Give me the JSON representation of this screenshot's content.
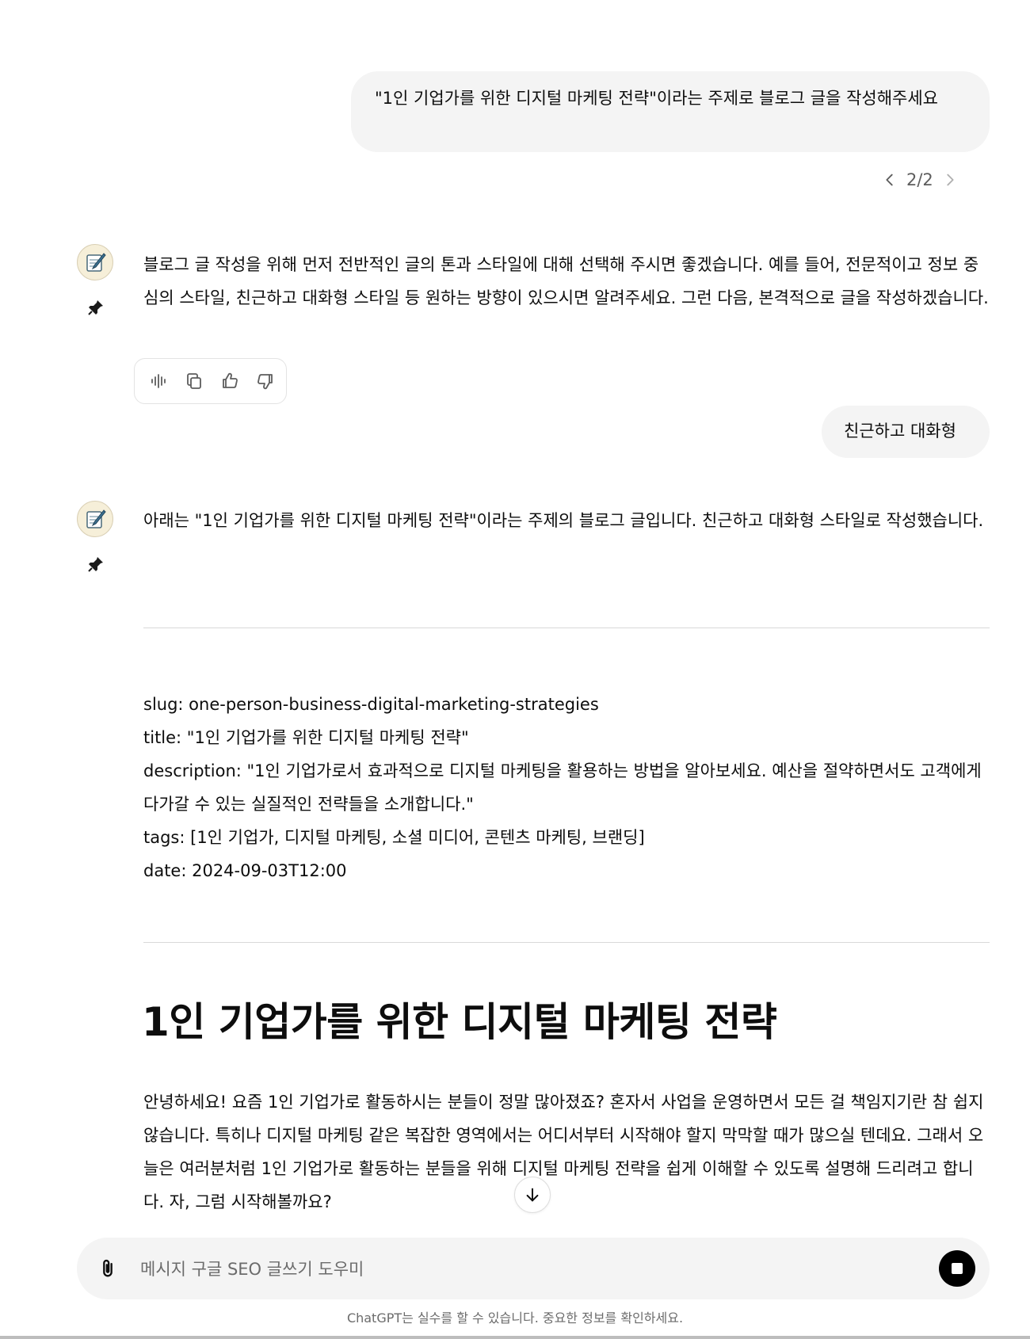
{
  "messages": {
    "user1": "\"1인 기업가를 위한 디지털 마케팅 전략\"이라는 주제로 블로그 글을 작성해주세요",
    "pager": "2/2",
    "assistant1": "블로그 글 작성을 위해 먼저 전반적인 글의 톤과 스타일에 대해 선택해 주시면 좋겠습니다. 예를 들어, 전문적이고 정보 중심의 스타일, 친근하고 대화형 스타일 등 원하는 방향이 있으시면 알려주세요. 그런 다음, 본격적으로 글을 작성하겠습니다.",
    "user2": "친근하고 대화형",
    "assistant2": "아래는 \"1인 기업가를 위한 디지털 마케팅 전략\"이라는 주제의 블로그 글입니다. 친근하고 대화형 스타일로 작성했습니다."
  },
  "actions": [
    "read-aloud-icon",
    "copy-icon",
    "thumbs-up-icon",
    "thumbs-down-icon"
  ],
  "meta": {
    "slug": "slug: one-person-business-digital-marketing-strategies",
    "title": "title: \"1인 기업가를 위한 디지털 마케팅 전략\"",
    "description": "description: \"1인 기업가로서 효과적으로 디지털 마케팅을 활용하는 방법을 알아보세요. 예산을 절약하면서도 고객에게 다가갈 수 있는 실질적인 전략들을 소개합니다.\"",
    "tags": "tags: [1인 기업가, 디지털 마케팅, 소셜 미디어, 콘텐츠 마케팅, 브랜딩]",
    "date": "date: 2024-09-03T12:00"
  },
  "blog": {
    "heading": "1인 기업가를 위한 디지털 마케팅 전략",
    "intro": "안녕하세요! 요즘 1인 기업가로 활동하시는 분들이 정말 많아졌죠? 혼자서 사업을 운영하면서 모든 걸 책임지기란 참 쉽지 않습니다. 특히나 디지털 마케팅 같은 복잡한 영역에서는 어디서부터 시작해야 할지 막막할 때가 많으실 텐데요. 그래서 오늘은 여러분처럼 1인 기업가로 활동하는 분들을 위해 디지털 마케팅 전략을 쉽게 이해할 수 있도록 설명해 드리려고 합니다. 자, 그럼 시작해볼까요?"
  },
  "composer": {
    "placeholder": "메시지 구글 SEO 글쓰기 도우미"
  },
  "footer": "ChatGPT는 실수를 할 수 있습니다. 중요한 정보를 확인하세요.",
  "colors": {
    "bubble": "#f4f4f4",
    "text": "#0d0d0d",
    "muted": "#6b6b6b",
    "stop_button": "#000000"
  }
}
